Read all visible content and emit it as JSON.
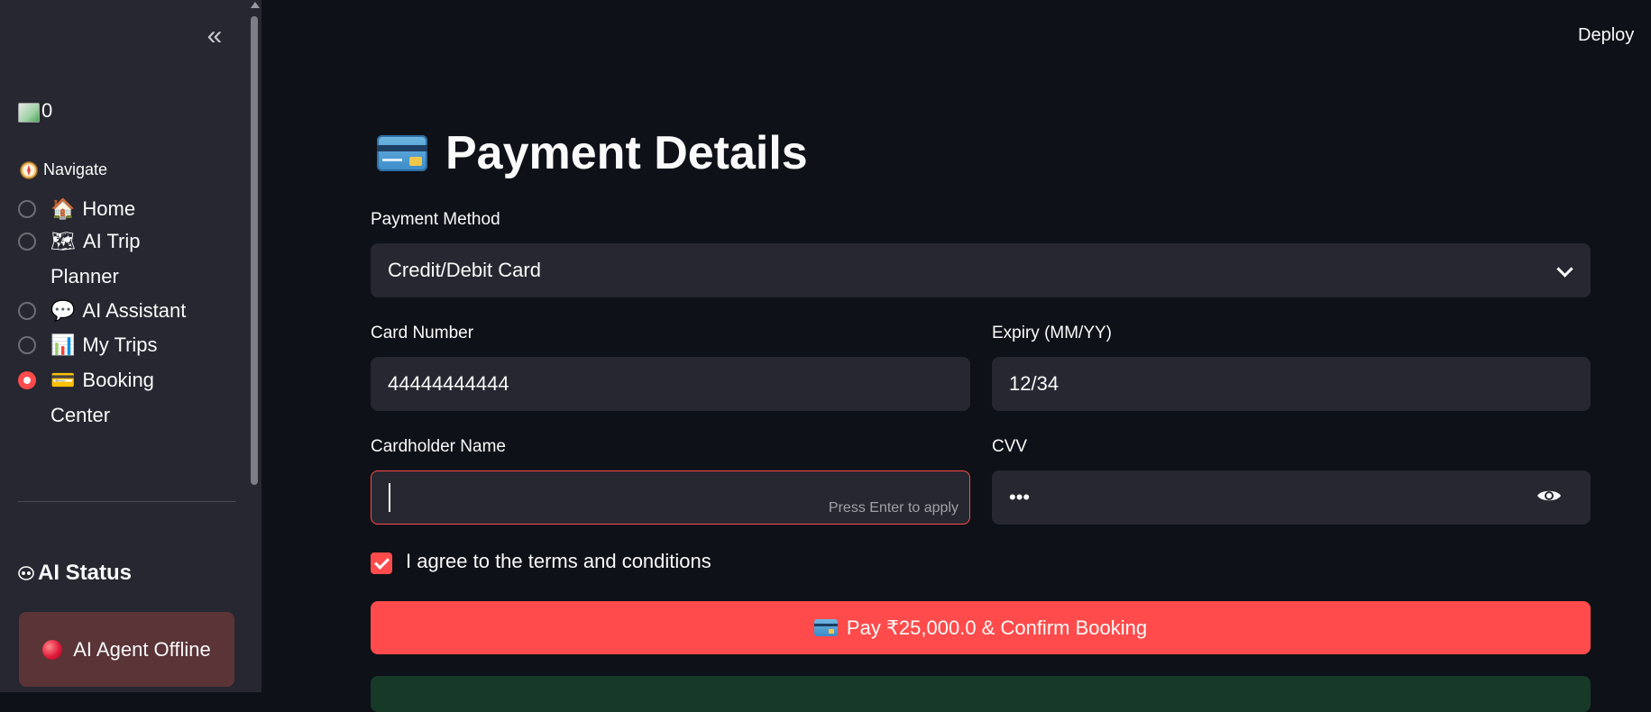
{
  "sidebar": {
    "logo_alt": "0",
    "nav_label": "Navigate",
    "nav_icon": "compass-icon",
    "items": [
      {
        "icon": "🏠",
        "label": "Home",
        "selected": false
      },
      {
        "icon": "🗺",
        "label": "AI Trip Planner",
        "selected": false
      },
      {
        "icon": "💬",
        "label": "AI Assistant",
        "selected": false
      },
      {
        "icon": "📊",
        "label": "My Trips",
        "selected": false
      },
      {
        "icon": "💳",
        "label": "Booking Center",
        "selected": true
      }
    ],
    "ai_status_title": "AI Status",
    "ai_status_message": "AI Agent Offline"
  },
  "header": {
    "deploy_label": "Deploy"
  },
  "main": {
    "title": "Payment Details",
    "payment_method_label": "Payment Method",
    "payment_method_value": "Credit/Debit Card",
    "card_number_label": "Card Number",
    "card_number_value": "44444444444",
    "expiry_label": "Expiry (MM/YY)",
    "expiry_value": "12/34",
    "cardholder_label": "Cardholder Name",
    "cardholder_value": "",
    "cardholder_hint": "Press Enter to apply",
    "cvv_label": "CVV",
    "cvv_value": "•••",
    "terms_label": "I agree to the terms and conditions",
    "terms_checked": true,
    "pay_button_label": "Pay ₹25,000.0 & Confirm Booking"
  },
  "colors": {
    "accent": "#ff4b4b",
    "background": "#0e1117",
    "sidebar": "#262730",
    "success_bg": "#173928"
  }
}
